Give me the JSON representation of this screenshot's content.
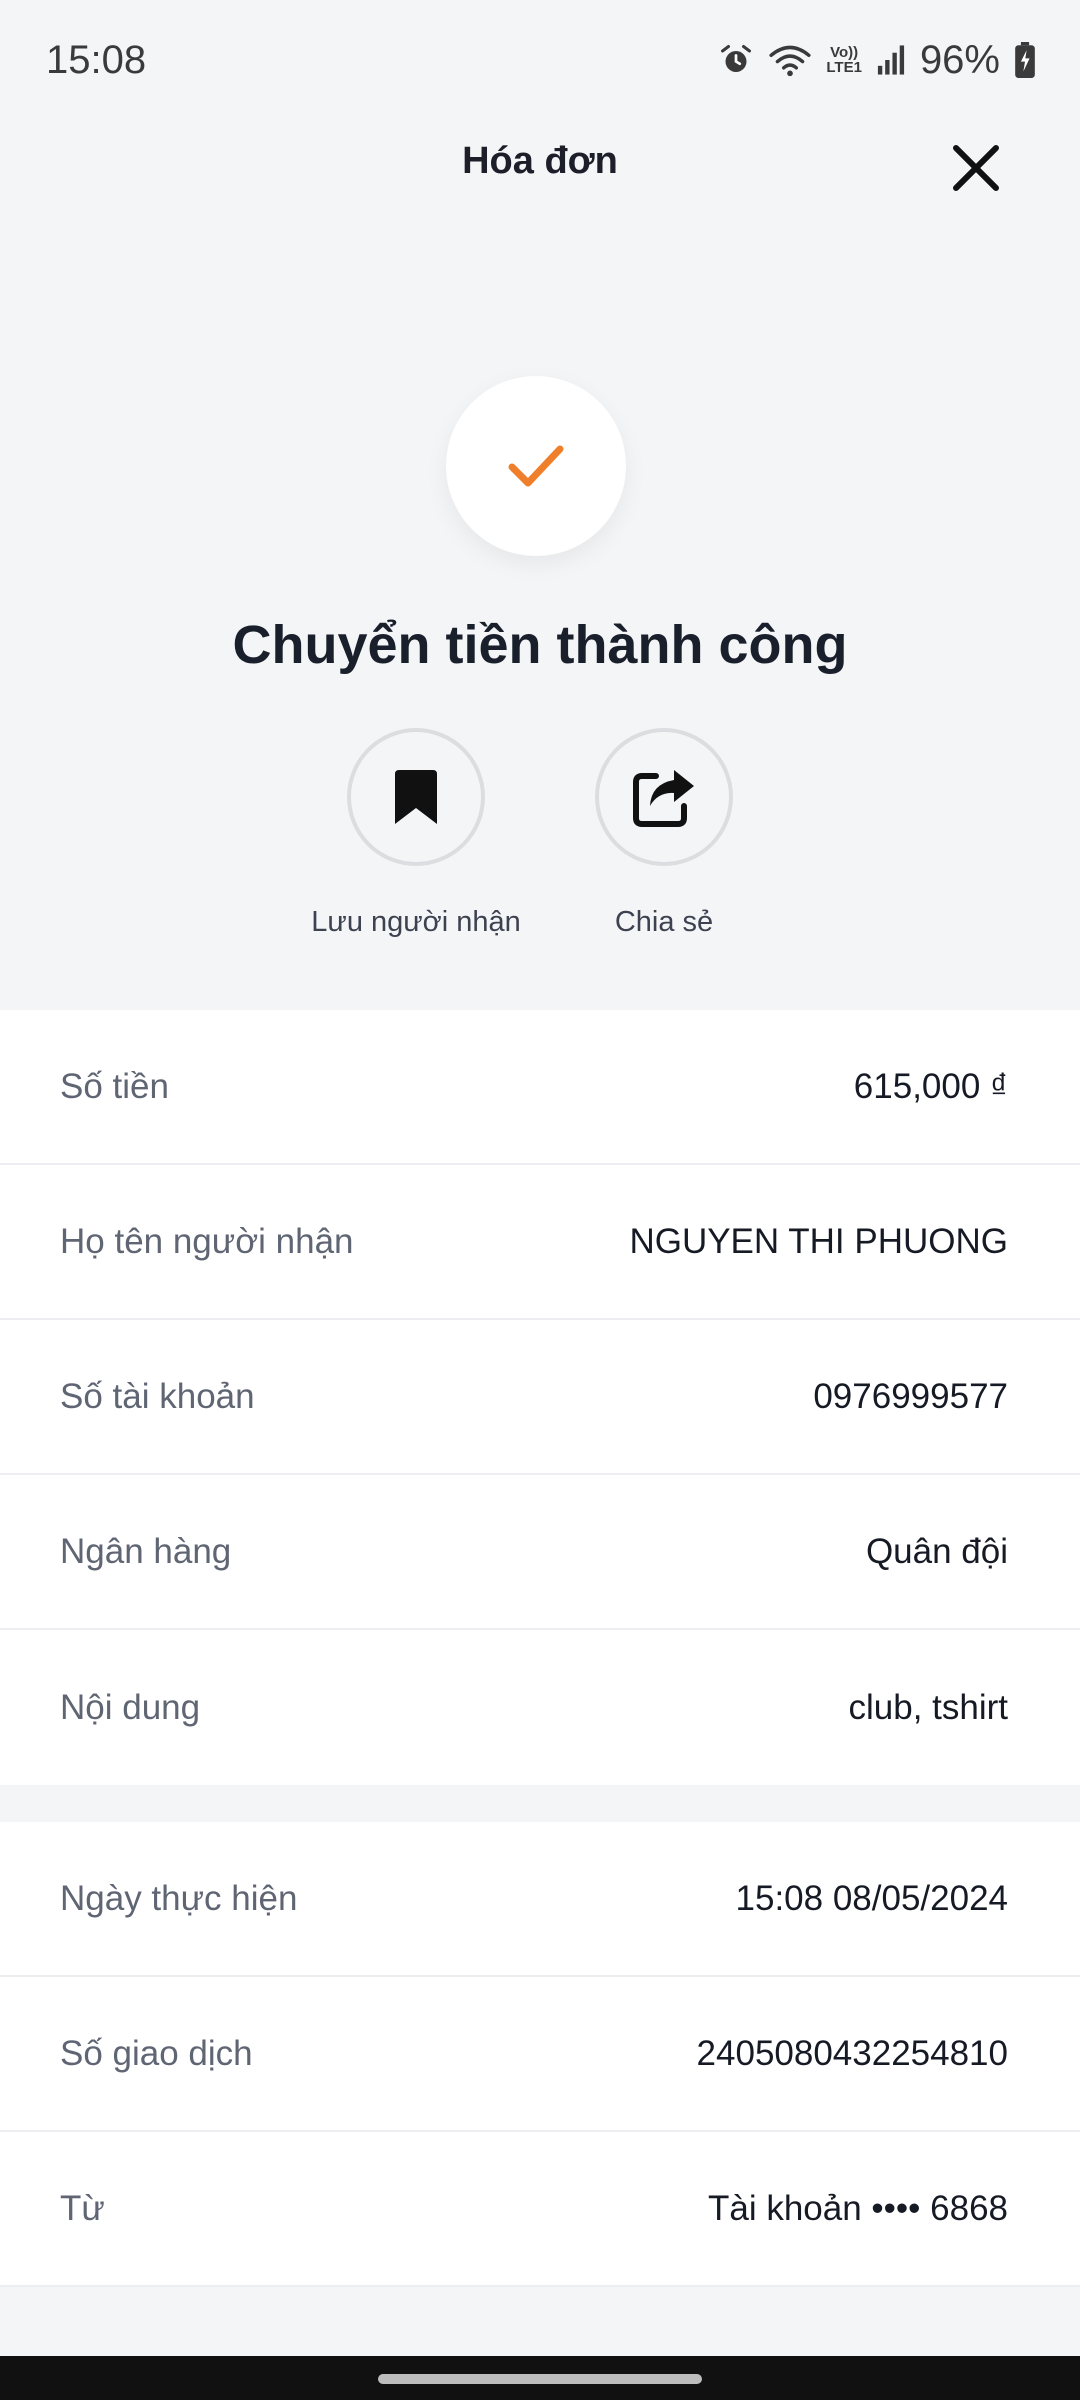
{
  "status_bar": {
    "time": "15:08",
    "battery": "96%",
    "icons": [
      "alarm-icon",
      "wifi-icon",
      "volte-icon",
      "signal-icon",
      "battery-icon"
    ],
    "network_label_top": "Vo))",
    "network_label_bottom": "LTE1"
  },
  "header": {
    "title": "Hóa đơn",
    "close_icon": "close-icon"
  },
  "success": {
    "icon": "check-icon",
    "accent_color": "#f07f2c",
    "title": "Chuyển tiền thành công"
  },
  "actions": [
    {
      "label": "Lưu người nhận",
      "icon": "bookmark-icon"
    },
    {
      "label": "Chia sẻ",
      "icon": "share-icon"
    }
  ],
  "details": [
    {
      "label": "Số tiền",
      "value": "615,000 ₫"
    },
    {
      "label": "Họ tên người nhận",
      "value": "NGUYEN THI PHUONG"
    },
    {
      "label": "Số tài khoản",
      "value": "0976999577"
    },
    {
      "label": "Ngân hàng",
      "value": "Quân đội"
    },
    {
      "label": "Nội dung",
      "value": "club, tshirt"
    }
  ],
  "transaction": [
    {
      "label": "Ngày thực hiện",
      "value": "15:08 08/05/2024"
    },
    {
      "label": "Số giao dịch",
      "value": "2405080432254810"
    },
    {
      "label": "Từ",
      "value": "Tài khoản •••• 6868"
    }
  ]
}
